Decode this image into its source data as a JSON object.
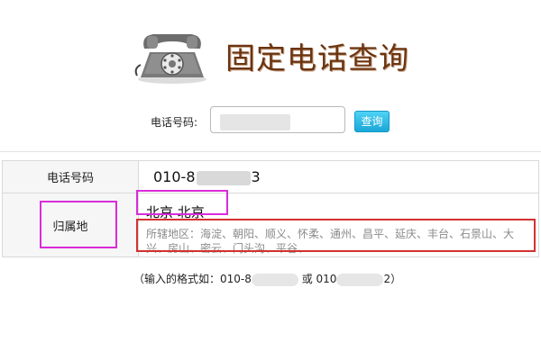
{
  "header": {
    "title": "固定电话查询",
    "logo_icon": "telephone-icon"
  },
  "search": {
    "label": "电话号码:",
    "button_label": "查询",
    "input_value": ""
  },
  "result": {
    "phone_label": "电话号码",
    "phone_prefix": "010-8",
    "phone_suffix": "3",
    "region_label": "归属地",
    "region_value": "北京 北京",
    "districts": "所辖地区：海淀、朝阳、顺义、怀柔、通州、昌平、延庆、丰台、石景山、大兴、房山、密云、门头沟、平谷、"
  },
  "hint": {
    "prefix": "（输入的格式如：010-8",
    "middle": "或 010",
    "suffix": "2）"
  },
  "colors": {
    "title": "#6b3410",
    "button": "#1aa6d8",
    "annotation_magenta": "#d92cd9",
    "annotation_red": "#d43030"
  }
}
